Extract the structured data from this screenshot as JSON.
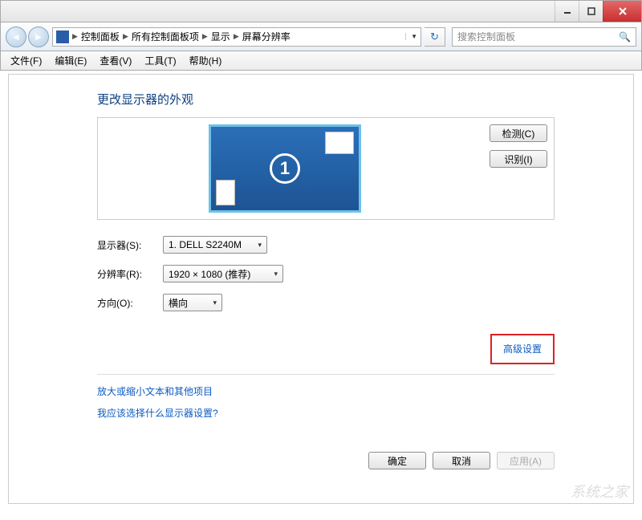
{
  "titlebar": {
    "min": "minimize",
    "max": "maximize",
    "close": "close"
  },
  "nav": {
    "crumbs": [
      "控制面板",
      "所有控制面板项",
      "显示",
      "屏幕分辨率"
    ],
    "search_placeholder": "搜索控制面板"
  },
  "menu": {
    "file": "文件(F)",
    "edit": "编辑(E)",
    "view": "查看(V)",
    "tools": "工具(T)",
    "help": "帮助(H)"
  },
  "page": {
    "heading": "更改显示器的外观",
    "display_number": "1",
    "detect_btn": "检测(C)",
    "identify_btn": "识别(I)",
    "labels": {
      "display": "显示器(S):",
      "resolution": "分辨率(R):",
      "orientation": "方向(O):"
    },
    "values": {
      "display": "1. DELL S2240M",
      "resolution": "1920 × 1080 (推荐)",
      "orientation": "横向"
    },
    "advanced_link": "高级设置",
    "link_text_size": "放大或缩小文本和其他项目",
    "link_help": "我应该选择什么显示器设置?",
    "ok_btn": "确定",
    "cancel_btn": "取消",
    "apply_btn": "应用(A)"
  },
  "watermark": "系统之家"
}
